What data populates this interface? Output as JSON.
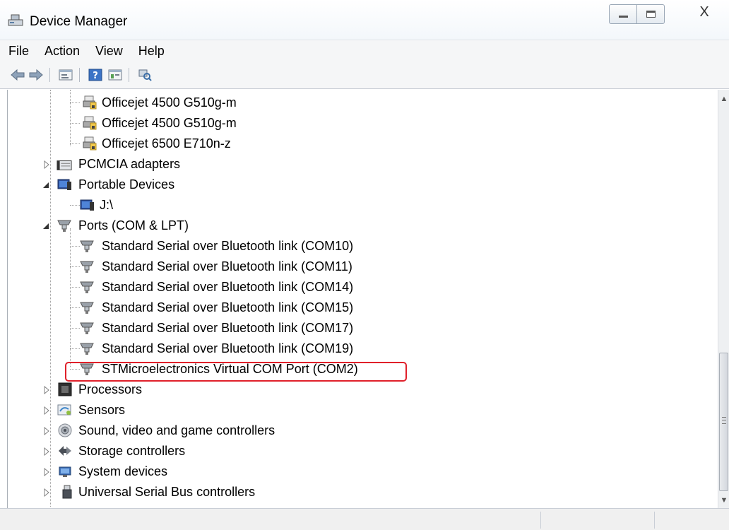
{
  "window": {
    "title": "Device Manager",
    "icon": "device-manager-icon",
    "controls": [
      "minimize-icon",
      "maximize-icon",
      "close-icon"
    ],
    "close_glyph": "X"
  },
  "menu": [
    "File",
    "Action",
    "View",
    "Help"
  ],
  "toolbar": [
    "back-arrow-icon",
    "forward-arrow-icon",
    "properties-icon",
    "help-icon",
    "show-hide-icon",
    "scan-hardware-icon"
  ],
  "tree": [
    {
      "label": "Officejet 4500 G510g-m",
      "icon": "printer-warning-icon",
      "level": 2
    },
    {
      "label": "Officejet 4500 G510g-m",
      "icon": "printer-warning-icon",
      "level": 2
    },
    {
      "label": "Officejet 6500 E710n-z",
      "icon": "printer-warning-icon",
      "level": 2
    },
    {
      "label": "PCMCIA adapters",
      "icon": "pcmcia-icon",
      "level": 1,
      "expander": "collapsed"
    },
    {
      "label": "Portable Devices",
      "icon": "portable-device-icon",
      "level": 1,
      "expander": "expanded"
    },
    {
      "label": "J:\\",
      "icon": "portable-device-icon",
      "level": 2
    },
    {
      "label": "Ports (COM & LPT)",
      "icon": "port-icon",
      "level": 1,
      "expander": "expanded"
    },
    {
      "label": "Standard Serial over Bluetooth link (COM10)",
      "icon": "port-icon",
      "level": 2
    },
    {
      "label": "Standard Serial over Bluetooth link (COM11)",
      "icon": "port-icon",
      "level": 2
    },
    {
      "label": "Standard Serial over Bluetooth link (COM14)",
      "icon": "port-icon",
      "level": 2
    },
    {
      "label": "Standard Serial over Bluetooth link (COM15)",
      "icon": "port-icon",
      "level": 2
    },
    {
      "label": "Standard Serial over Bluetooth link (COM17)",
      "icon": "port-icon",
      "level": 2
    },
    {
      "label": "Standard Serial over Bluetooth link (COM19)",
      "icon": "port-icon",
      "level": 2
    },
    {
      "label": "STMicroelectronics Virtual COM Port (COM2)",
      "icon": "port-icon",
      "level": 2,
      "highlighted": true
    },
    {
      "label": "Processors",
      "icon": "processor-icon",
      "level": 1,
      "expander": "collapsed"
    },
    {
      "label": "Sensors",
      "icon": "sensor-icon",
      "level": 1,
      "expander": "collapsed"
    },
    {
      "label": "Sound, video and game controllers",
      "icon": "speaker-icon",
      "level": 1,
      "expander": "collapsed"
    },
    {
      "label": "Storage controllers",
      "icon": "storage-controller-icon",
      "level": 1,
      "expander": "collapsed"
    },
    {
      "label": "System devices",
      "icon": "system-devices-icon",
      "level": 1,
      "expander": "collapsed"
    },
    {
      "label": "Universal Serial Bus controllers",
      "icon": "usb-icon",
      "level": 1,
      "expander": "collapsed"
    }
  ],
  "colors": {
    "highlight_border": "#e0202a",
    "menubar_bg": "#f5f6f7"
  }
}
